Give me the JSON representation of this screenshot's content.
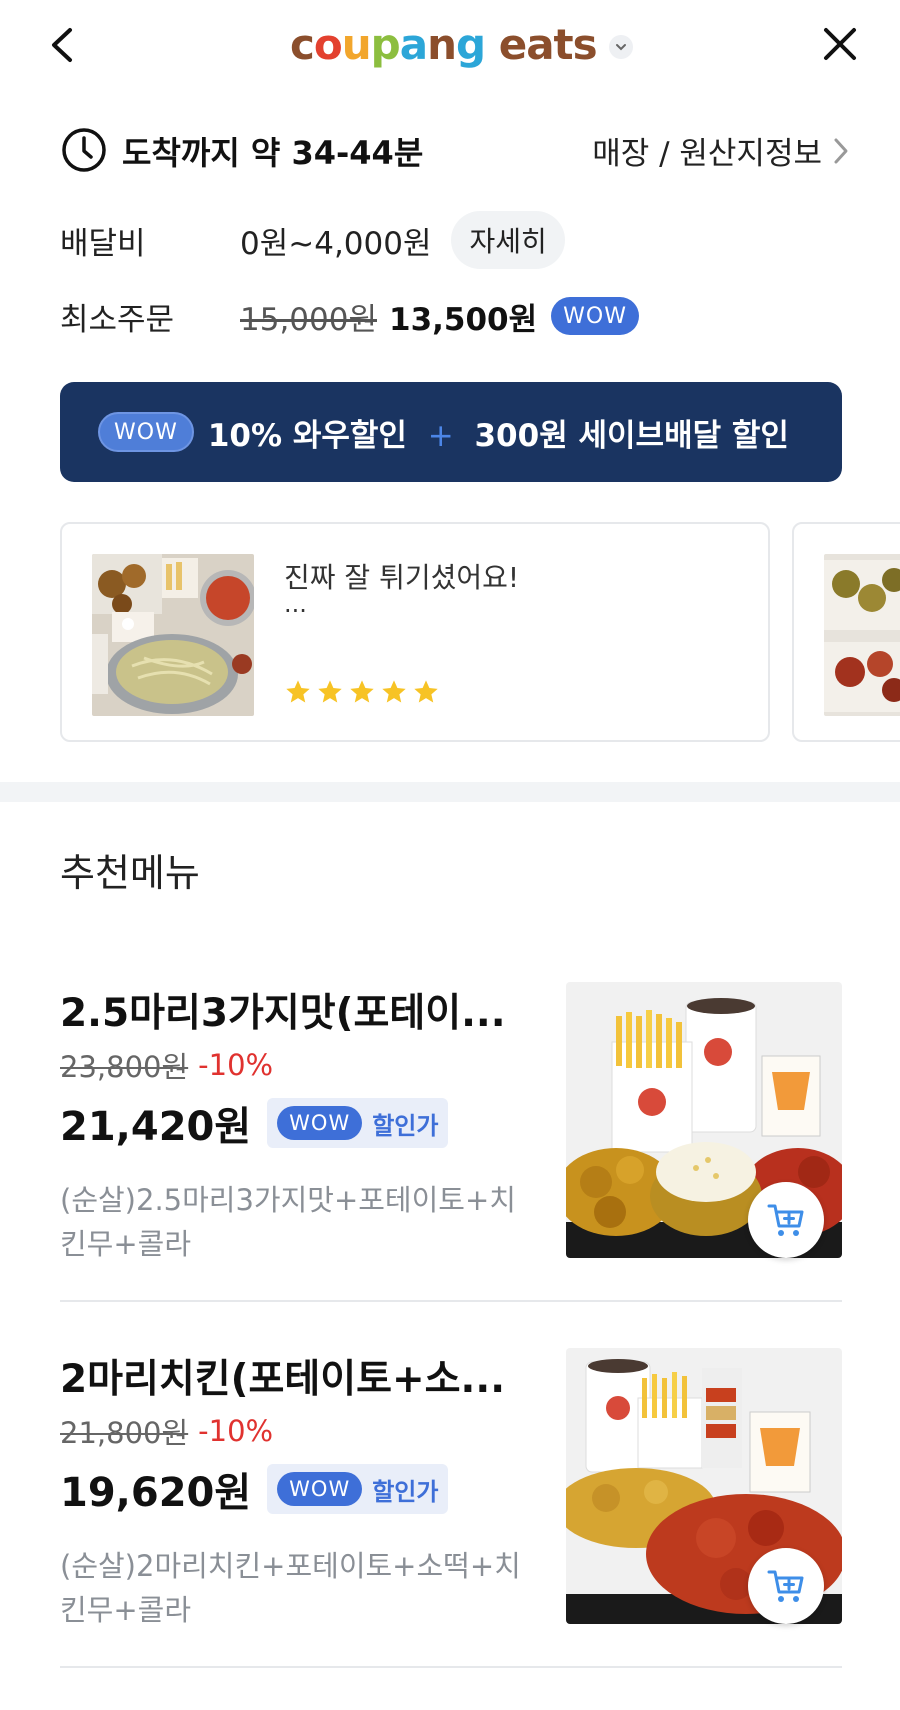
{
  "header": {
    "logo_letters": [
      {
        "ch": "c",
        "color": "#8b4e2c"
      },
      {
        "ch": "o",
        "color": "#e3412f"
      },
      {
        "ch": "u",
        "color": "#f2a62c"
      },
      {
        "ch": "p",
        "color": "#8cbe3f"
      },
      {
        "ch": "a",
        "color": "#2ca6d8"
      },
      {
        "ch": "n",
        "color": "#8b4e2c"
      },
      {
        "ch": "g",
        "color": "#2ca6d8"
      },
      {
        "ch": " ",
        "color": "#000000"
      },
      {
        "ch": "e",
        "color": "#8b4e2c"
      },
      {
        "ch": "a",
        "color": "#8b4e2c"
      },
      {
        "ch": "t",
        "color": "#8b4e2c"
      },
      {
        "ch": "s",
        "color": "#8b4e2c"
      }
    ],
    "back_icon": "chevron-left-icon",
    "close_icon": "close-icon"
  },
  "delivery": {
    "eta": "도착까지 약 34-44분",
    "store_info_link": "매장 / 원산지정보",
    "fee_label": "배달비",
    "fee_value": "0원~4,000원",
    "fee_detail_button": "자세히",
    "min_order_label": "최소주문",
    "min_order_original": "15,000원",
    "min_order_discounted": "13,500원",
    "wow_badge": "WOW"
  },
  "promo": {
    "wow_badge": "WOW",
    "text_part1": "10% 와우할인",
    "plus": "+",
    "text_part2": "300원 세이브배달 할인",
    "bg_color": "#1a3461"
  },
  "reviews": [
    {
      "text": "진짜 잘 튀기셨어요!",
      "more": "...",
      "rating": 5
    }
  ],
  "section_title": "추천메뉴",
  "menu_items": [
    {
      "name": "2.5마리3가지맛(포테이...",
      "original_price": "23,800원",
      "discount": "-10%",
      "sale_price": "21,420원",
      "wow_badge": "WOW",
      "sale_label": "할인가",
      "description": "(순살)2.5마리3가지맛+포테이토+치킨무+콜라"
    },
    {
      "name": "2마리치킨(포테이토+소...",
      "original_price": "21,800원",
      "discount": "-10%",
      "sale_price": "19,620원",
      "wow_badge": "WOW",
      "sale_label": "할인가",
      "description": "(순살)2마리치킨+포테이토+소떡+치킨무+콜라"
    }
  ],
  "colors": {
    "accent_blue": "#3e6fd8",
    "discount_red": "#e0322f",
    "star_yellow": "#f7c325"
  }
}
